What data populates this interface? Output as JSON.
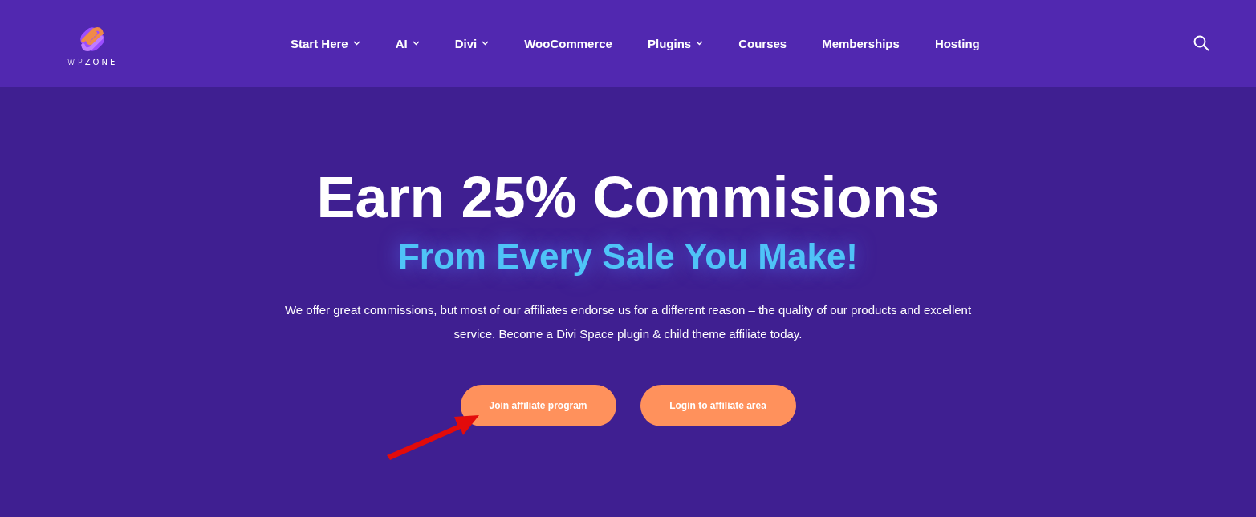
{
  "header": {
    "logo": "WP**ZONE**",
    "nav": [
      {
        "label": "Start Here",
        "has_menu": true
      },
      {
        "label": "AI",
        "has_menu": true
      },
      {
        "label": "Divi",
        "has_menu": true
      },
      {
        "label": "WooCommerce",
        "has_menu": false
      },
      {
        "label": "Plugins",
        "has_menu": true
      },
      {
        "label": "Courses",
        "has_menu": false
      },
      {
        "label": "Memberships",
        "has_menu": false
      },
      {
        "label": "Hosting",
        "has_menu": false
      }
    ]
  },
  "hero": {
    "title": "Earn 25% Commisions",
    "subtitle": "From Every Sale You Make!",
    "text": "We offer great commissions, but most of our affiliates endorse us for a different reason – the quality of our products and excellent service. Become a Divi Space plugin & child theme affiliate today.",
    "buttons": [
      "Join affiliate program",
      "Login to affiliate area"
    ]
  }
}
